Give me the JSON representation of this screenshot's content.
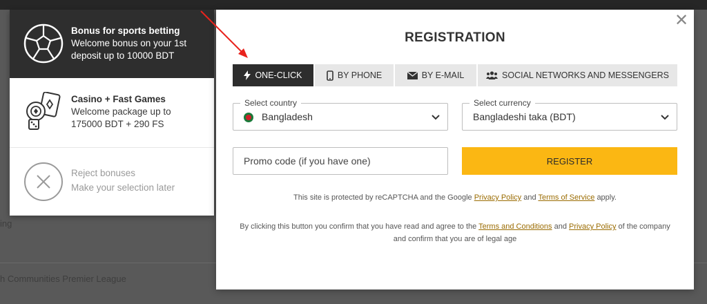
{
  "background": {
    "league_text": "h Communities Premier League",
    "partial_text": "ing"
  },
  "bonus_panel": {
    "items": [
      {
        "title": "Bonus for sports betting",
        "desc": "Welcome bonus on your 1st deposit up to 10000 BDT",
        "icon": "soccer-ball-icon"
      },
      {
        "title": "Casino + Fast Games",
        "desc": "Welcome package up to 175000 BDT + 290 FS",
        "icon": "casino-chips-icon"
      },
      {
        "title": "Reject bonuses",
        "desc": "Make your selection later",
        "icon": "close-circle-icon"
      }
    ]
  },
  "modal": {
    "title": "REGISTRATION",
    "close": "✕",
    "tabs": [
      {
        "label": "ONE-CLICK",
        "icon": "lightning-icon",
        "active": true
      },
      {
        "label": "BY PHONE",
        "icon": "phone-icon",
        "active": false
      },
      {
        "label": "BY E-MAIL",
        "icon": "envelope-icon",
        "active": false
      },
      {
        "label": "SOCIAL NETWORKS AND MESSENGERS",
        "icon": "users-icon",
        "active": false
      }
    ],
    "country": {
      "label": "Select country",
      "value": "Bangladesh"
    },
    "currency": {
      "label": "Select currency",
      "value": "Bangladeshi taka (BDT)"
    },
    "promo": {
      "placeholder": "Promo code (if you have one)"
    },
    "register_label": "REGISTER",
    "recaptcha": {
      "prefix": "This site is protected by reCAPTCHA and the Google",
      "privacy": "Privacy Policy",
      "and": "and",
      "terms": "Terms of Service",
      "suffix": "apply."
    },
    "consent": {
      "prefix": "By clicking this button you confirm that you have read and agree to the",
      "terms": "Terms and Conditions",
      "and": "and",
      "privacy": "Privacy Policy",
      "suffix": "of the company and confirm that you are of legal age"
    }
  },
  "colors": {
    "accent": "#fbb713",
    "active_tab": "#2d2d2d",
    "link": "#9a6b00",
    "arrow": "#e8231d"
  }
}
